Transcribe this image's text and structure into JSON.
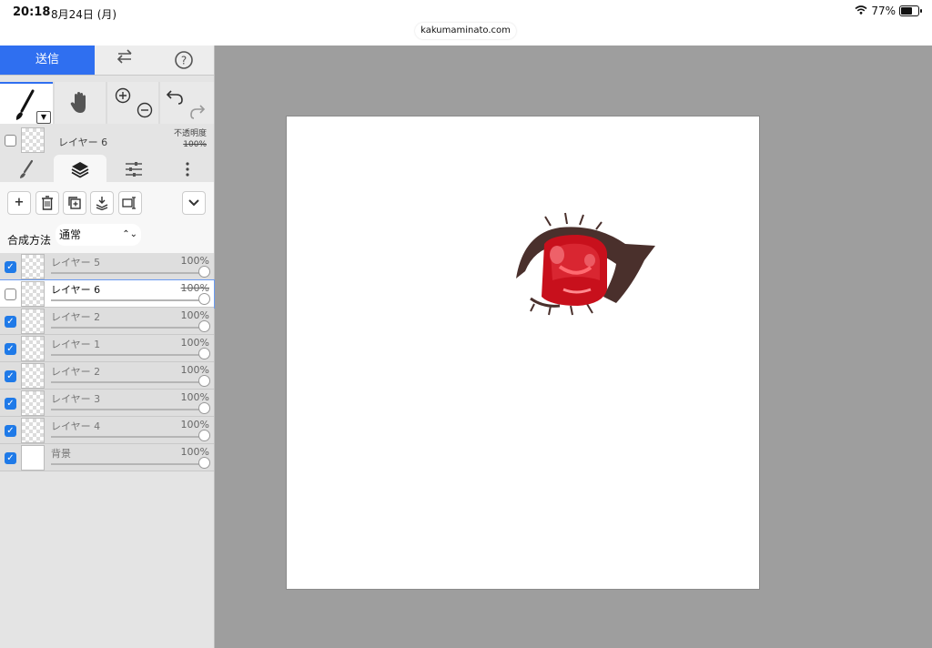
{
  "status_bar": {
    "time": "20:18",
    "date": "8月24日 (月)",
    "url": "kakumaminato.com",
    "battery_percent": "77%",
    "battery_level": 0.77
  },
  "top_bar": {
    "send_label": "送信",
    "swap_icon": "swap-arrows-icon",
    "help_icon": "help-circle-icon"
  },
  "tools": {
    "active": "brush",
    "items": [
      "brush",
      "hand",
      "zoom",
      "undo-redo"
    ]
  },
  "current_layer": {
    "name": "レイヤー 6",
    "opacity_label": "不透明度",
    "opacity_value": "100%"
  },
  "panel_tabs": [
    "brush",
    "layers",
    "adjust",
    "more"
  ],
  "active_tab": "layers",
  "blend": {
    "label": "合成方法",
    "value": "通常"
  },
  "layers": [
    {
      "name": "レイヤー 5",
      "opacity": "100%",
      "visible": true,
      "selected": false
    },
    {
      "name": "レイヤー 6",
      "opacity": "100%",
      "visible": false,
      "selected": true
    },
    {
      "name": "レイヤー 2",
      "opacity": "100%",
      "visible": true,
      "selected": false
    },
    {
      "name": "レイヤー 1",
      "opacity": "100%",
      "visible": true,
      "selected": false
    },
    {
      "name": "レイヤー 2",
      "opacity": "100%",
      "visible": true,
      "selected": false
    },
    {
      "name": "レイヤー 3",
      "opacity": "100%",
      "visible": true,
      "selected": false
    },
    {
      "name": "レイヤー 4",
      "opacity": "100%",
      "visible": true,
      "selected": false
    },
    {
      "name": "背景",
      "opacity": "100%",
      "visible": true,
      "selected": false
    }
  ],
  "colors": {
    "accent": "#2f6ff0",
    "checkbox": "#1f7ae8",
    "eye_red": "#c8101c",
    "lash": "#4a302c"
  }
}
